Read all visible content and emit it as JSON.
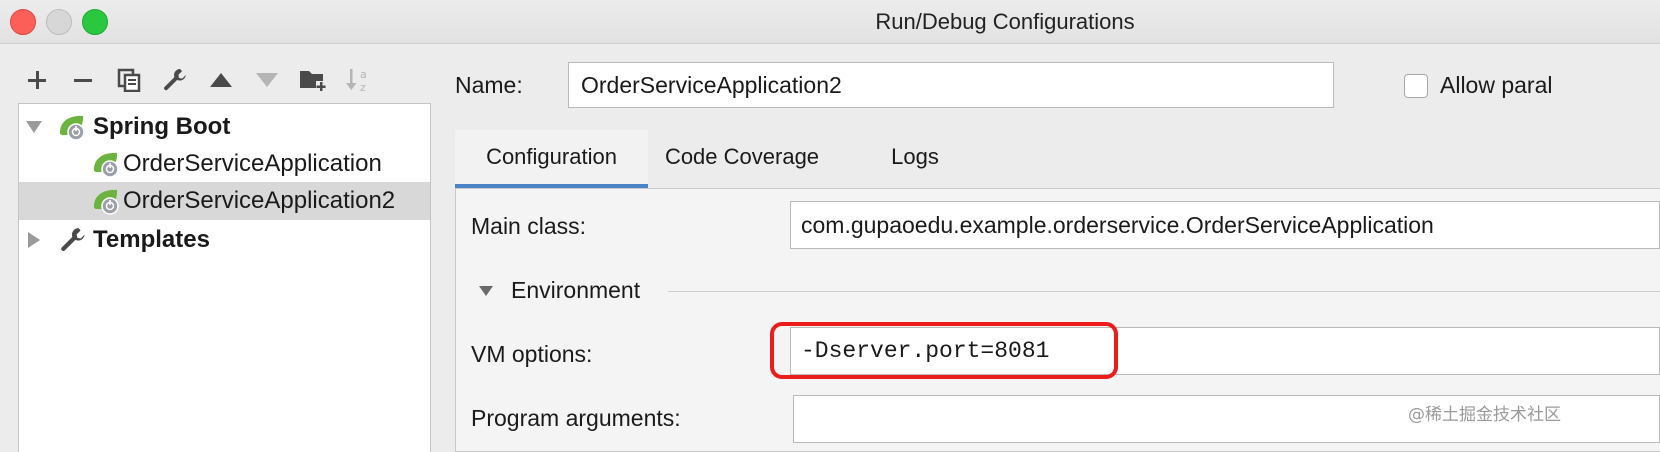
{
  "window": {
    "title": "Run/Debug Configurations"
  },
  "toolbar": {
    "buttons": [
      {
        "name": "add-button",
        "icon": "plus-icon"
      },
      {
        "name": "remove-button",
        "icon": "minus-icon"
      },
      {
        "name": "copy-button",
        "icon": "copy-icon"
      },
      {
        "name": "edit-defaults-button",
        "icon": "wrench-icon"
      },
      {
        "name": "move-up-button",
        "icon": "triangle-up-icon"
      },
      {
        "name": "move-down-button",
        "icon": "triangle-down-icon"
      },
      {
        "name": "new-folder-button",
        "icon": "folder-add-icon"
      },
      {
        "name": "sort-button",
        "icon": "sort-az-icon"
      }
    ]
  },
  "tree": {
    "spring_boot": "Spring Boot",
    "items": [
      "OrderServiceApplication",
      "OrderServiceApplication2"
    ],
    "selected": "OrderServiceApplication2",
    "templates": "Templates"
  },
  "config": {
    "name_label": "Name:",
    "name_value": "OrderServiceApplication2",
    "allow_parallel": "Allow paral",
    "tabs": [
      "Configuration",
      "Code Coverage",
      "Logs"
    ],
    "active_tab": "Configuration",
    "main_class_label": "Main class:",
    "main_class_value": "com.gupaoedu.example.orderservice.OrderServiceApplication",
    "environment_label": "Environment",
    "vm_options_label": "VM options:",
    "vm_options_value": "-Dserver.port=8081",
    "program_args_label": "Program arguments:",
    "program_args_value": ""
  },
  "watermark": "@稀土掘金技术社区",
  "colors": {
    "accent_tab": "#4a84c7",
    "highlight_border": "#ea1c1c",
    "spring_green": "#6db33f"
  }
}
